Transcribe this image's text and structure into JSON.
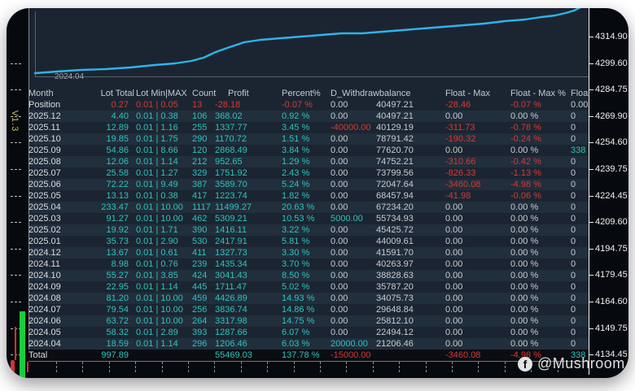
{
  "version_label": "V1.3",
  "watermark": {
    "icon": "facebook-icon",
    "icon_glyph": "f",
    "text": "@Mushroom"
  },
  "colors": {
    "teal": "#2ec4bd",
    "red": "#d43b35",
    "gray": "#c6ccd2",
    "white": "#d9dde1",
    "line": "#2fb3ea",
    "background": "#1b2531",
    "green_bar": "#17ce3d",
    "red_bar": "#d23333"
  },
  "chart": {
    "type": "line",
    "x_axis_label": "2024.04",
    "right_axis_ticks": [
      "4314.90",
      "4299.60",
      "4284.75",
      "4269.90",
      "4254.60",
      "4239.75",
      "4224.45",
      "4209.60",
      "4194.75",
      "4179.45",
      "4164.60",
      "4149.75",
      "4134.45"
    ],
    "line_points": [
      [
        43,
        90
      ],
      [
        70,
        88
      ],
      [
        100,
        86
      ],
      [
        130,
        85
      ],
      [
        160,
        83
      ],
      [
        190,
        80
      ],
      [
        215,
        78
      ],
      [
        235,
        75
      ],
      [
        250,
        71
      ],
      [
        265,
        64
      ],
      [
        282,
        58
      ],
      [
        300,
        52
      ],
      [
        320,
        49
      ],
      [
        345,
        47
      ],
      [
        370,
        45
      ],
      [
        395,
        43
      ],
      [
        420,
        41
      ],
      [
        445,
        41
      ],
      [
        470,
        39
      ],
      [
        495,
        37
      ],
      [
        520,
        35
      ],
      [
        545,
        33
      ],
      [
        570,
        31
      ],
      [
        595,
        29
      ],
      [
        620,
        26
      ],
      [
        645,
        24
      ],
      [
        665,
        21
      ],
      [
        682,
        19
      ],
      [
        695,
        16
      ],
      [
        705,
        13
      ],
      [
        713,
        9
      ],
      [
        719,
        4
      ],
      [
        723,
        0
      ]
    ]
  },
  "table": {
    "headers": [
      "Month",
      "Lot Total",
      "Lot Min|MAX",
      "Count",
      "Profit",
      "Percent%",
      "D_Withdrawbalance",
      "",
      "Float - Max",
      "Float - Max %",
      "Float"
    ],
    "rows": [
      [
        [
          "Position",
          "w"
        ],
        [
          "0.27",
          "r"
        ],
        [
          "0.01 | 0.05",
          "r"
        ],
        [
          "13",
          "r"
        ],
        [
          "-28.18",
          "r"
        ],
        [
          "-0.07 %",
          "r"
        ],
        [
          "0.00",
          "g"
        ],
        [
          "40497.21",
          "g"
        ],
        [
          "-28.46",
          "r"
        ],
        [
          "-0.07 %",
          "r"
        ],
        [
          "0.00",
          "g"
        ]
      ],
      [
        [
          "2025.12",
          "w"
        ],
        [
          "4.40",
          "t"
        ],
        [
          "0.01 | 0.38",
          "t"
        ],
        [
          "106",
          "t"
        ],
        [
          "368.02",
          "t"
        ],
        [
          "0.92 %",
          "t"
        ],
        [
          "0.00",
          "g"
        ],
        [
          "40497.21",
          "g"
        ],
        [
          "0.00",
          "g"
        ],
        [
          "0.00 %",
          "g"
        ],
        [
          "0",
          "g"
        ]
      ],
      [
        [
          "2025.11",
          "w"
        ],
        [
          "12.89",
          "t"
        ],
        [
          "0.01 | 1.16",
          "t"
        ],
        [
          "255",
          "t"
        ],
        [
          "1337.77",
          "t"
        ],
        [
          "3.45 %",
          "t"
        ],
        [
          "-40000.00",
          "r"
        ],
        [
          "40129.19",
          "g"
        ],
        [
          "-311.73",
          "r"
        ],
        [
          "-0.78 %",
          "r"
        ],
        [
          "0",
          "g"
        ]
      ],
      [
        [
          "2025.10",
          "w"
        ],
        [
          "19.85",
          "t"
        ],
        [
          "0.01 | 1.75",
          "t"
        ],
        [
          "290",
          "t"
        ],
        [
          "1170.72",
          "t"
        ],
        [
          "1.51 %",
          "t"
        ],
        [
          "0.00",
          "g"
        ],
        [
          "78791.42",
          "g"
        ],
        [
          "-190.32",
          "r"
        ],
        [
          "-0.24 %",
          "r"
        ],
        [
          "0",
          "g"
        ]
      ],
      [
        [
          "2025.09",
          "w"
        ],
        [
          "54.86",
          "t"
        ],
        [
          "0.01 | 8.66",
          "t"
        ],
        [
          "120",
          "t"
        ],
        [
          "2868.49",
          "t"
        ],
        [
          "3.84 %",
          "t"
        ],
        [
          "0.00",
          "g"
        ],
        [
          "77620.70",
          "g"
        ],
        [
          "0.00",
          "g"
        ],
        [
          "0.00 %",
          "g"
        ],
        [
          "338",
          "t"
        ]
      ],
      [
        [
          "2025.08",
          "w"
        ],
        [
          "12.06",
          "t"
        ],
        [
          "0.01 | 1.14",
          "t"
        ],
        [
          "212",
          "t"
        ],
        [
          "952.65",
          "t"
        ],
        [
          "1.29 %",
          "t"
        ],
        [
          "0.00",
          "g"
        ],
        [
          "74752.21",
          "g"
        ],
        [
          "-310.66",
          "r"
        ],
        [
          "-0.42 %",
          "r"
        ],
        [
          "0",
          "g"
        ]
      ],
      [
        [
          "2025.07",
          "w"
        ],
        [
          "25.58",
          "t"
        ],
        [
          "0.01 | 1.27",
          "t"
        ],
        [
          "329",
          "t"
        ],
        [
          "1751.92",
          "t"
        ],
        [
          "2.43 %",
          "t"
        ],
        [
          "0.00",
          "g"
        ],
        [
          "73799.56",
          "g"
        ],
        [
          "-826.33",
          "r"
        ],
        [
          "-1.13 %",
          "r"
        ],
        [
          "0",
          "g"
        ]
      ],
      [
        [
          "2025.06",
          "w"
        ],
        [
          "72.22",
          "t"
        ],
        [
          "0.01 | 9.49",
          "t"
        ],
        [
          "387",
          "t"
        ],
        [
          "3589.70",
          "t"
        ],
        [
          "5.24 %",
          "t"
        ],
        [
          "0.00",
          "g"
        ],
        [
          "72047.64",
          "g"
        ],
        [
          "-3460.08",
          "r"
        ],
        [
          "-4.98 %",
          "r"
        ],
        [
          "0",
          "g"
        ]
      ],
      [
        [
          "2025.05",
          "w"
        ],
        [
          "13.13",
          "t"
        ],
        [
          "0.01 | 0.38",
          "t"
        ],
        [
          "417",
          "t"
        ],
        [
          "1223.74",
          "t"
        ],
        [
          "1.82 %",
          "t"
        ],
        [
          "0.00",
          "g"
        ],
        [
          "68457.94",
          "g"
        ],
        [
          "-41.98",
          "r"
        ],
        [
          "-0.06 %",
          "r"
        ],
        [
          "0",
          "g"
        ]
      ],
      [
        [
          "2025.04",
          "w"
        ],
        [
          "233.47",
          "t"
        ],
        [
          "0.01 | 10.00",
          "t"
        ],
        [
          "1117",
          "t"
        ],
        [
          "11499.27",
          "t"
        ],
        [
          "20.63 %",
          "t"
        ],
        [
          "0.00",
          "g"
        ],
        [
          "67234.20",
          "g"
        ],
        [
          "0.00",
          "g"
        ],
        [
          "0.00 %",
          "g"
        ],
        [
          "0",
          "g"
        ]
      ],
      [
        [
          "2025.03",
          "w"
        ],
        [
          "91.27",
          "t"
        ],
        [
          "0.01 | 10.00",
          "t"
        ],
        [
          "462",
          "t"
        ],
        [
          "5309.21",
          "t"
        ],
        [
          "10.53 %",
          "t"
        ],
        [
          "5000.00",
          "t"
        ],
        [
          "55734.93",
          "g"
        ],
        [
          "0.00",
          "g"
        ],
        [
          "0.00 %",
          "g"
        ],
        [
          "0",
          "g"
        ]
      ],
      [
        [
          "2025.02",
          "w"
        ],
        [
          "19.92",
          "t"
        ],
        [
          "0.01 | 1.71",
          "t"
        ],
        [
          "390",
          "t"
        ],
        [
          "1416.11",
          "t"
        ],
        [
          "3.22 %",
          "t"
        ],
        [
          "0.00",
          "g"
        ],
        [
          "45425.72",
          "g"
        ],
        [
          "0.00",
          "g"
        ],
        [
          "0.00 %",
          "g"
        ],
        [
          "0",
          "g"
        ]
      ],
      [
        [
          "2025.01",
          "w"
        ],
        [
          "35.73",
          "t"
        ],
        [
          "0.01 | 2.90",
          "t"
        ],
        [
          "530",
          "t"
        ],
        [
          "2417.91",
          "t"
        ],
        [
          "5.81 %",
          "t"
        ],
        [
          "0.00",
          "g"
        ],
        [
          "44009.61",
          "g"
        ],
        [
          "0.00",
          "g"
        ],
        [
          "0.00 %",
          "g"
        ],
        [
          "0",
          "g"
        ]
      ],
      [
        [
          "2024.12",
          "w"
        ],
        [
          "13.67",
          "t"
        ],
        [
          "0.01 | 0.61",
          "t"
        ],
        [
          "411",
          "t"
        ],
        [
          "1327.73",
          "t"
        ],
        [
          "3.30 %",
          "t"
        ],
        [
          "0.00",
          "g"
        ],
        [
          "41591.70",
          "g"
        ],
        [
          "0.00",
          "g"
        ],
        [
          "0.00 %",
          "g"
        ],
        [
          "0",
          "g"
        ]
      ],
      [
        [
          "2024.11",
          "w"
        ],
        [
          "8.98",
          "t"
        ],
        [
          "0.01 | 0.76",
          "t"
        ],
        [
          "239",
          "t"
        ],
        [
          "1435.34",
          "t"
        ],
        [
          "3.70 %",
          "t"
        ],
        [
          "0.00",
          "g"
        ],
        [
          "40263.97",
          "g"
        ],
        [
          "0.00",
          "g"
        ],
        [
          "0.00 %",
          "g"
        ],
        [
          "0",
          "g"
        ]
      ],
      [
        [
          "2024.10",
          "w"
        ],
        [
          "55.27",
          "t"
        ],
        [
          "0.01 | 3.85",
          "t"
        ],
        [
          "424",
          "t"
        ],
        [
          "3041.43",
          "t"
        ],
        [
          "8.50 %",
          "t"
        ],
        [
          "0.00",
          "g"
        ],
        [
          "38828.63",
          "g"
        ],
        [
          "0.00",
          "g"
        ],
        [
          "0.00 %",
          "g"
        ],
        [
          "0",
          "g"
        ]
      ],
      [
        [
          "2024.09",
          "w"
        ],
        [
          "22.95",
          "t"
        ],
        [
          "0.01 | 1.14",
          "t"
        ],
        [
          "445",
          "t"
        ],
        [
          "1711.47",
          "t"
        ],
        [
          "5.02 %",
          "t"
        ],
        [
          "0.00",
          "g"
        ],
        [
          "35787.20",
          "g"
        ],
        [
          "0.00",
          "g"
        ],
        [
          "0.00 %",
          "g"
        ],
        [
          "0",
          "g"
        ]
      ],
      [
        [
          "2024.08",
          "w"
        ],
        [
          "81.20",
          "t"
        ],
        [
          "0.01 | 10.00",
          "t"
        ],
        [
          "459",
          "t"
        ],
        [
          "4426.89",
          "t"
        ],
        [
          "14.93 %",
          "t"
        ],
        [
          "0.00",
          "g"
        ],
        [
          "34075.73",
          "g"
        ],
        [
          "0.00",
          "g"
        ],
        [
          "0.00 %",
          "g"
        ],
        [
          "0",
          "g"
        ]
      ],
      [
        [
          "2024.07",
          "w"
        ],
        [
          "79.54",
          "t"
        ],
        [
          "0.01 | 10.00",
          "t"
        ],
        [
          "256",
          "t"
        ],
        [
          "3836.74",
          "t"
        ],
        [
          "14.86 %",
          "t"
        ],
        [
          "0.00",
          "g"
        ],
        [
          "29648.84",
          "g"
        ],
        [
          "0.00",
          "g"
        ],
        [
          "0.00 %",
          "g"
        ],
        [
          "0",
          "g"
        ]
      ],
      [
        [
          "2024.06",
          "w"
        ],
        [
          "63.72",
          "t"
        ],
        [
          "0.01 | 10.00",
          "t"
        ],
        [
          "264",
          "t"
        ],
        [
          "3317.98",
          "t"
        ],
        [
          "14.75 %",
          "t"
        ],
        [
          "0.00",
          "g"
        ],
        [
          "25812.10",
          "g"
        ],
        [
          "0.00",
          "g"
        ],
        [
          "0.00 %",
          "g"
        ],
        [
          "0",
          "g"
        ]
      ],
      [
        [
          "2024.05",
          "w"
        ],
        [
          "58.32",
          "t"
        ],
        [
          "0.01 | 2.89",
          "t"
        ],
        [
          "393",
          "t"
        ],
        [
          "1287.66",
          "t"
        ],
        [
          "6.07 %",
          "t"
        ],
        [
          "0.00",
          "g"
        ],
        [
          "22494.12",
          "g"
        ],
        [
          "0.00",
          "g"
        ],
        [
          "0.00 %",
          "g"
        ],
        [
          "0",
          "g"
        ]
      ],
      [
        [
          "2024.04",
          "w"
        ],
        [
          "18.59",
          "t"
        ],
        [
          "0.01 | 1.14",
          "t"
        ],
        [
          "296",
          "t"
        ],
        [
          "1206.46",
          "t"
        ],
        [
          "6.03 %",
          "t"
        ],
        [
          "20000.00",
          "t"
        ],
        [
          "21206.46",
          "g"
        ],
        [
          "0.00",
          "g"
        ],
        [
          "0.00 %",
          "g"
        ],
        [
          "0",
          "g"
        ]
      ]
    ],
    "total": [
      [
        "Total",
        "w"
      ],
      [
        "997.89",
        "t"
      ],
      [
        "",
        ""
      ],
      [
        "",
        ""
      ],
      [
        "55469.03",
        "t"
      ],
      [
        "137.78 %",
        "t"
      ],
      [
        "-15000.00",
        "r"
      ],
      [
        "",
        ""
      ],
      [
        "-3460.08",
        "r"
      ],
      [
        "-4.98 %",
        "r"
      ],
      [
        "338",
        "t"
      ]
    ]
  }
}
